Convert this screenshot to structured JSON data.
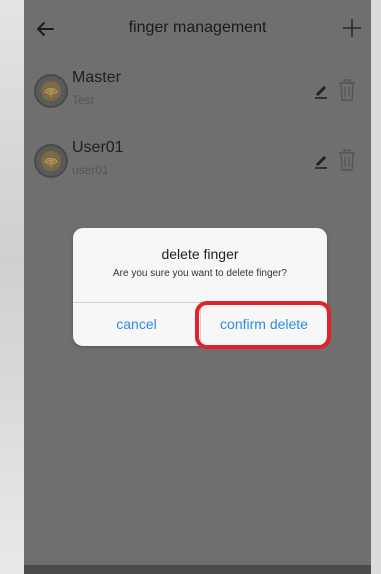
{
  "header": {
    "title": "finger management",
    "back_icon": "arrow-left-icon",
    "add_icon": "plus-icon"
  },
  "fingers": [
    {
      "name": "Master",
      "subtitle": "Test",
      "icon": "fingerprint-icon"
    },
    {
      "name": "User01",
      "subtitle": "user01",
      "icon": "fingerprint-icon"
    }
  ],
  "dialog": {
    "title": "delete finger",
    "message": "Are you sure you want to delete finger?",
    "cancel_label": "cancel",
    "confirm_label": "confirm delete"
  },
  "colors": {
    "accent": "#2f8be0",
    "highlight": "#e2222b",
    "overlay": "#6f6f6f"
  }
}
